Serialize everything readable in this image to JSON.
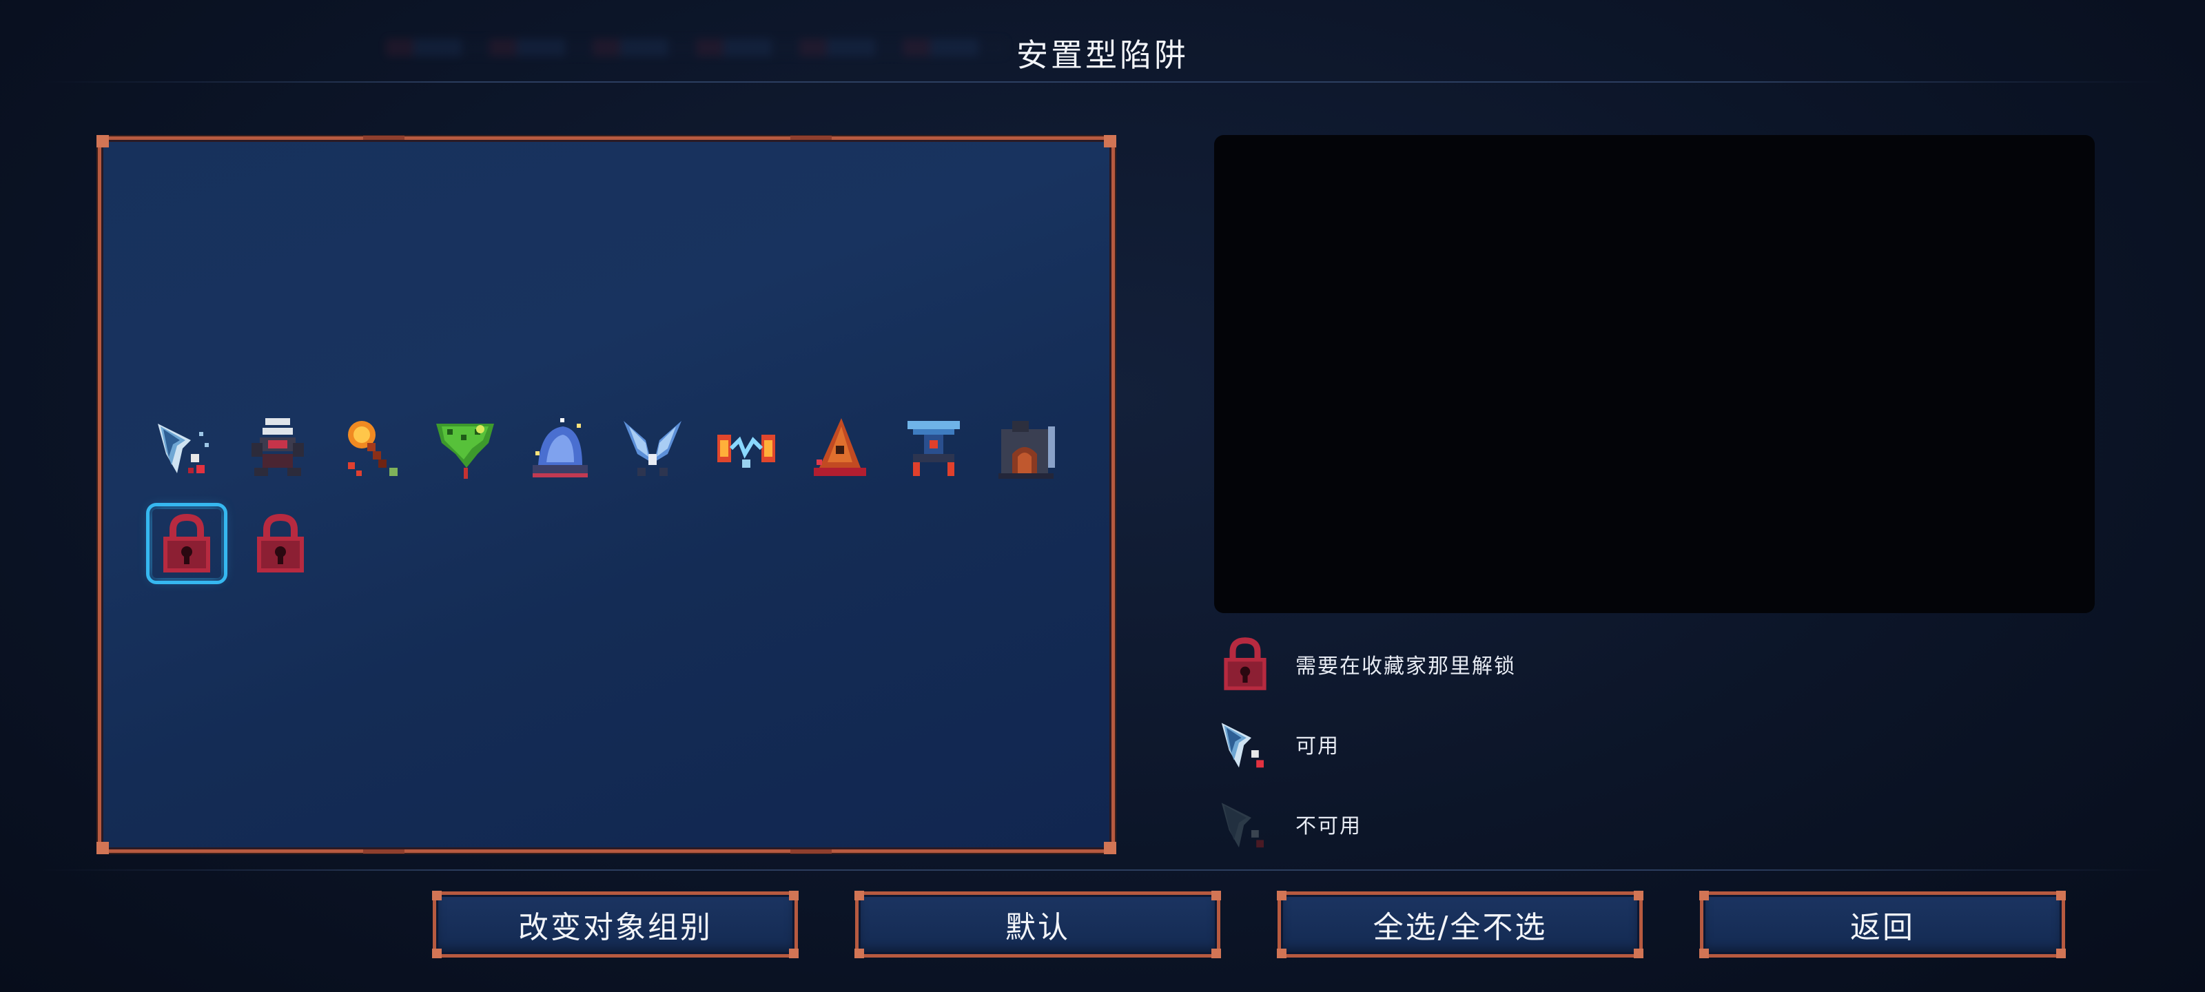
{
  "header": {
    "title": "安置型陷阱"
  },
  "items": [
    {
      "name": "spear-trap-icon",
      "status": "available"
    },
    {
      "name": "crusher-turret-icon",
      "status": "available"
    },
    {
      "name": "fire-torch-icon",
      "status": "available"
    },
    {
      "name": "vine-plant-icon",
      "status": "available"
    },
    {
      "name": "crystal-dome-icon",
      "status": "available"
    },
    {
      "name": "blade-wings-icon",
      "status": "available"
    },
    {
      "name": "tesla-coil-icon",
      "status": "available"
    },
    {
      "name": "flame-cone-icon",
      "status": "available"
    },
    {
      "name": "totem-turret-icon",
      "status": "available"
    },
    {
      "name": "furnace-box-icon",
      "status": "available"
    },
    {
      "name": "locked-item-icon",
      "status": "locked",
      "selected": true
    },
    {
      "name": "locked-item-icon",
      "status": "locked",
      "selected": false
    }
  ],
  "legend": {
    "locked_label": "需要在收藏家那里解锁",
    "available_label": "可用",
    "unavailable_label": "不可用"
  },
  "buttons": {
    "change_group": "改变对象组别",
    "default": "默认",
    "select_all": "全选/全不选",
    "back": "返回"
  },
  "colors": {
    "frame": "#b75a40",
    "selection": "#36b8f0",
    "panel": "#17315c",
    "lock": "#a8253c"
  }
}
